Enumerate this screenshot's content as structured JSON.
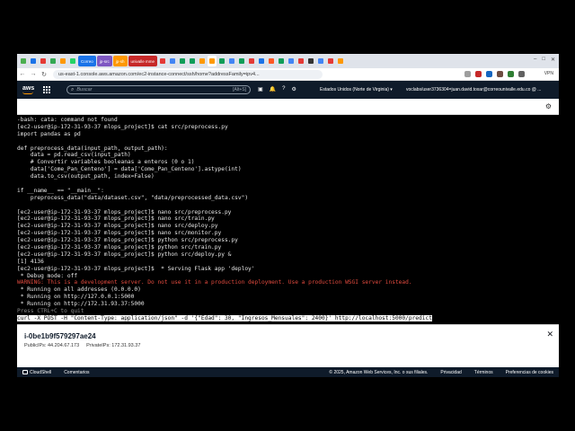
{
  "browser": {
    "tabs": [
      {
        "label": "",
        "color": "#4caf50"
      },
      {
        "label": "",
        "color": "#1a73e8"
      },
      {
        "label": "",
        "color": "#e53935"
      },
      {
        "label": "",
        "color": "#34a853"
      },
      {
        "label": "",
        "color": "#ff9800"
      },
      {
        "label": "",
        "color": "#25d366"
      },
      {
        "label": "Correo",
        "color": "#1a73e8"
      },
      {
        "label": "jp-src",
        "color": "#7e57c2"
      },
      {
        "label": "jp-sh",
        "color": "#ff9800"
      },
      {
        "label": "univalle mme",
        "color": "#c62828"
      },
      {
        "label": "",
        "color": "#e53935"
      },
      {
        "label": "",
        "color": "#4285f4"
      },
      {
        "label": "",
        "color": "#0f9d58"
      },
      {
        "label": "",
        "color": "#0f9d58"
      },
      {
        "label": "",
        "color": "#ff9900"
      },
      {
        "label": "",
        "color": "#ff9900"
      },
      {
        "label": "",
        "color": "#0f9d58"
      },
      {
        "label": "",
        "color": "#4285f4"
      },
      {
        "label": "",
        "color": "#0f9d58"
      },
      {
        "label": "",
        "color": "#e53935"
      },
      {
        "label": "",
        "color": "#1a73e8"
      },
      {
        "label": "",
        "color": "#ff5722"
      },
      {
        "label": "",
        "color": "#0f9d58"
      },
      {
        "label": "",
        "color": "#4285f4"
      },
      {
        "label": "",
        "color": "#e53935"
      },
      {
        "label": "",
        "color": "#333333"
      },
      {
        "label": "",
        "color": "#4285f4"
      },
      {
        "label": "",
        "color": "#e53935"
      },
      {
        "label": "",
        "color": "#ff9800"
      }
    ],
    "url": "us-east-1.console.aws.amazon.com/ec2-instance-connect/ssh/home?addressFamily=ipv4...",
    "vpn_label": "VPN"
  },
  "aws": {
    "logo": "aws",
    "search_placeholder": "Buscar",
    "search_shortcut": "[Alt+S]",
    "region": "Estados Unidos (Norte de Virginia) ▾",
    "account": "voclabs/user3736304=juan.david.toxar@correounivalle.edu.co @ ..."
  },
  "terminal": {
    "lines": [
      "-bash: cata: command not found",
      "[ec2-user@ip-172-31-93-37 mlops_project]$ cat src/preprocess.py",
      "import pandas as pd",
      "",
      "def preprocess_data(input_path, output_path):",
      "    data = pd.read_csv(input_path)",
      "    # Convertir variables booleanas a enteros (0 o 1)",
      "    data['Come_Pan_Centeno'] = data['Come_Pan_Centeno'].astype(int)",
      "    data.to_csv(output_path, index=False)",
      "",
      "if __name__ == \"__main__\":",
      "    preprocess_data(\"data/dataset.csv\", \"data/preprocessed_data.csv\")",
      "",
      "[ec2-user@ip-172-31-93-37 mlops_project]$ nano src/preprocess.py",
      "[ec2-user@ip-172-31-93-37 mlops_project]$ nano src/train.py",
      "[ec2-user@ip-172-31-93-37 mlops_project]$ nano src/deploy.py",
      "[ec2-user@ip-172-31-93-37 mlops_project]$ nano src/monitor.py",
      "[ec2-user@ip-172-31-93-37 mlops_project]$ python src/preprocess.py",
      "[ec2-user@ip-172-31-93-37 mlops_project]$ python src/train.py",
      "[ec2-user@ip-172-31-93-37 mlops_project]$ python src/deploy.py &",
      "[1] 4136",
      "[ec2-user@ip-172-31-93-37 mlops_project]$  * Serving Flask app 'deploy'",
      " * Debug mode: off",
      "WARNING: This is a development server. Do not use it in a production deployment. Use a production WSGI server instead.",
      " * Running on all addresses (0.0.0.0)",
      " * Running on http://127.0.0.1:5000",
      " * Running on http://172.31.93.37:5000",
      "Press CTRL+C to quit",
      "curl -X POST -H \"Content-Type: application/json\" -d '{\"Edad\": 30, \"Ingresos_Mensuales\": 2400}' http://localhost:5000/predict"
    ],
    "line_styles": [
      "",
      "",
      "",
      "",
      "",
      "",
      "",
      "",
      "",
      "",
      "",
      "",
      "",
      "",
      "",
      "",
      "",
      "",
      "",
      "",
      "",
      "",
      "",
      "red",
      "",
      "",
      "",
      "dim",
      "selected"
    ]
  },
  "instance": {
    "id": "i-0be1b9f579297ae24",
    "public_label": "PublicIPs: 44.204.67.173",
    "private_label": "PrivateIPs: 172.31.93.37"
  },
  "footer": {
    "cloudshell": "CloudShell",
    "comments": "Comentarios",
    "copyright": "© 2025, Amazon Web Services, Inc. o sus filiales.",
    "privacy": "Privacidad",
    "terms": "Términos",
    "cookies": "Preferencias de cookies"
  }
}
